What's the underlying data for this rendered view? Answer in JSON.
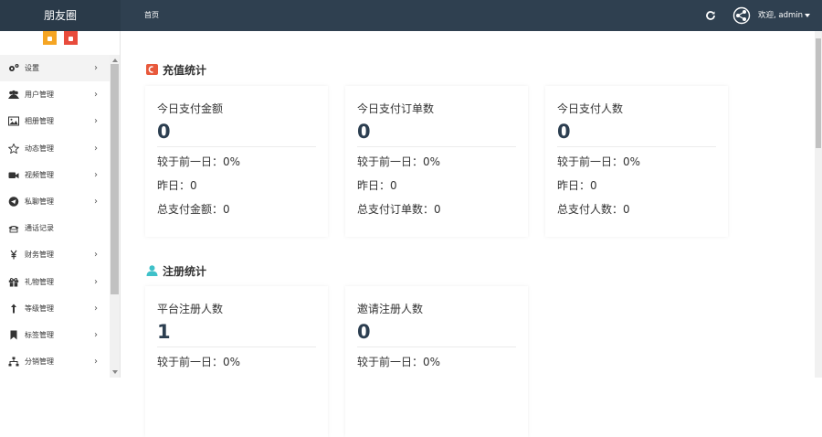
{
  "header": {
    "brand": "朋友圈",
    "home_tab": "首页",
    "welcome": "欢迎, admin",
    "icons": [
      "refresh-icon",
      "share-circle-icon",
      "caret-down-icon"
    ]
  },
  "sidebar": {
    "items": [
      {
        "label": "设置",
        "icon": "cogs-icon",
        "arrow": "›"
      },
      {
        "label": "用户管理",
        "icon": "users-icon",
        "arrow": "›"
      },
      {
        "label": "相册管理",
        "icon": "image-icon",
        "arrow": "›"
      },
      {
        "label": "动态管理",
        "icon": "star-icon",
        "arrow": "›"
      },
      {
        "label": "视频管理",
        "icon": "video-icon",
        "arrow": "›"
      },
      {
        "label": "私聊管理",
        "icon": "paper-plane-icon",
        "arrow": "›"
      },
      {
        "label": "通话记录",
        "icon": "phone-icon",
        "arrow": ""
      },
      {
        "label": "财务管理",
        "icon": "yen-icon",
        "arrow": "›"
      },
      {
        "label": "礼物管理",
        "icon": "gift-icon",
        "arrow": "›"
      },
      {
        "label": "等级管理",
        "icon": "level-up-icon",
        "arrow": "›"
      },
      {
        "label": "标签管理",
        "icon": "bookmark-icon",
        "arrow": "›"
      },
      {
        "label": "分销管理",
        "icon": "sitemap-icon",
        "arrow": "›"
      }
    ]
  },
  "recharge": {
    "title": "充值统计",
    "cards": [
      {
        "title": "今日支付金额",
        "value": "0",
        "l1": "较于前一日：0%",
        "l2": "昨日：0",
        "l3": "总支付金额：0"
      },
      {
        "title": "今日支付订单数",
        "value": "0",
        "l1": "较于前一日：0%",
        "l2": "昨日：0",
        "l3": "总支付订单数：0"
      },
      {
        "title": "今日支付人数",
        "value": "0",
        "l1": "较于前一日：0%",
        "l2": "昨日：0",
        "l3": "总支付人数：0"
      }
    ]
  },
  "register": {
    "title": "注册统计",
    "cards": [
      {
        "title": "平台注册人数",
        "value": "1",
        "l1": "较于前一日：0%"
      },
      {
        "title": "邀请注册人数",
        "value": "0",
        "l1": "较于前一日：0%"
      }
    ]
  },
  "colors": {
    "topbar": "#2f4050",
    "recharge_icon": "#e8593c",
    "register_icon": "#3fc1c9",
    "value_text": "#2c3e50"
  }
}
